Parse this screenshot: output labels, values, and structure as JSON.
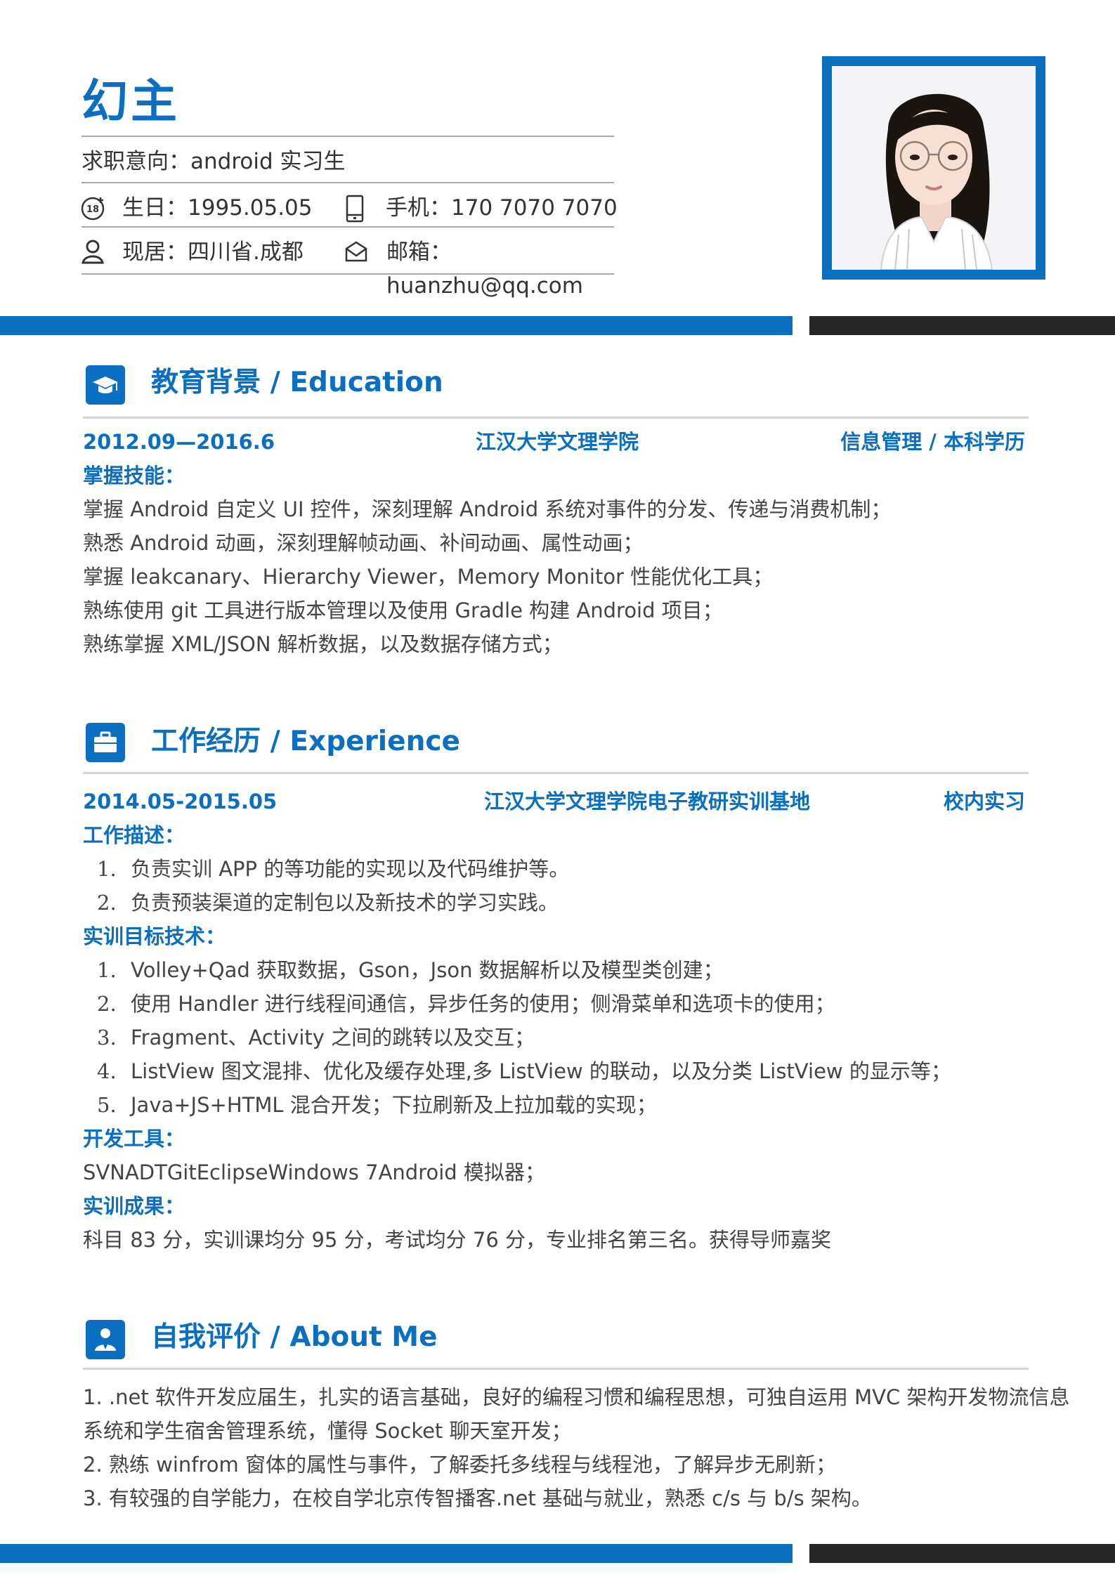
{
  "header": {
    "name": "幻主",
    "intent": "求职意向：android 实习生",
    "birthday": "生日：1995.05.05",
    "phone": "手机：170 7070 7070",
    "location": "现居：四川省.成都",
    "email_label": "邮箱：",
    "email_value": "huanzhu@qq.com",
    "icons": [
      "age-18-icon",
      "phone-icon",
      "person-icon",
      "mail-icon"
    ]
  },
  "colors": {
    "accent": "#0b6fc1",
    "dark": "#262626",
    "rule": "#d4d4d4"
  },
  "education": {
    "title": "教育背景 / Education",
    "icon": "graduation-cap-icon",
    "period": "2012.09—2016.6",
    "school": "江汉大学文理学院",
    "major": "信息管理 / 本科学历",
    "skills_label": "掌握技能：",
    "skills": [
      "掌握 Android 自定义 UI 控件，深刻理解 Android 系统对事件的分发、传递与消费机制；",
      "熟悉 Android 动画，深刻理解帧动画、补间动画、属性动画；",
      "掌握 leakcanary、Hierarchy Viewer，Memory Monitor 性能优化工具；",
      "熟练使用 git 工具进行版本管理以及使用 Gradle 构建 Android 项目；",
      "熟练掌握 XML/JSON 解析数据，以及数据存储方式；"
    ]
  },
  "experience": {
    "title": "工作经历 / Experience",
    "icon": "briefcase-icon",
    "period": "2014.05-2015.05",
    "org": "江汉大学文理学院电子教研实训基地",
    "type": "校内实习",
    "desc_label": "工作描述：",
    "desc": [
      {
        "n": "1.",
        "t": "负责实训 APP 的等功能的实现以及代码维护等。"
      },
      {
        "n": "2.",
        "t": "负责预装渠道的定制包以及新技术的学习实践。"
      }
    ],
    "tech_label": "实训目标技术：",
    "tech": [
      {
        "n": "1.",
        "t": "Volley+Qad 获取数据，Gson，Json 数据解析以及模型类创建；"
      },
      {
        "n": "2.",
        "t": "使用 Handler 进行线程间通信，异步任务的使用；侧滑菜单和选项卡的使用；"
      },
      {
        "n": "3.",
        "t": "Fragment、Activity 之间的跳转以及交互；"
      },
      {
        "n": "4.",
        "t": "ListView 图文混排、优化及缓存处理,多 ListView 的联动，以及分类 ListView 的显示等；"
      },
      {
        "n": "5.",
        "t": "Java+JS+HTML 混合开发；下拉刷新及上拉加载的实现；"
      }
    ],
    "tools_label": "开发工具：",
    "tools": "SVNADTGitEclipseWindows 7Android 模拟器；",
    "result_label": "实训成果：",
    "result": "科目 83 分，实训课均分 95 分，考试均分 76 分，专业排名第三名。获得导师嘉奖"
  },
  "about": {
    "title": "自我评价 / About Me",
    "icon": "user-tie-icon",
    "lines": [
      "1. .net 软件开发应届生，扎实的语言基础，良好的编程习惯和编程思想，可独自运用 MVC 架构开发物流信息",
      "系统和学生宿舍管理系统，懂得 Socket 聊天室开发；",
      "2. 熟练 winfrom 窗体的属性与事件，了解委托多线程与线程池，了解异步无刷新；",
      "3. 有较强的自学能力，在校自学北京传智播客.net 基础与就业，熟悉 c/s 与 b/s 架构。"
    ]
  }
}
